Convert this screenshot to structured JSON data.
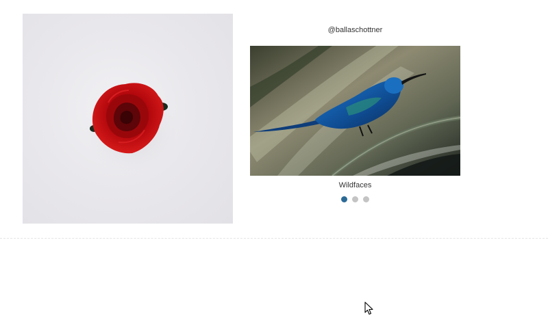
{
  "gallery": {
    "left_image": {
      "icon": "rose-photo"
    },
    "carousel": {
      "handle": "@ballaschottner",
      "image": {
        "icon": "hummingbird-photo"
      },
      "caption": "Wildfaces",
      "slides": 3,
      "active_slide": 1
    }
  },
  "colors": {
    "active_dot": "#2c6a96",
    "inactive_dot": "#c4c4c4",
    "divider": "#e3e3e3"
  }
}
